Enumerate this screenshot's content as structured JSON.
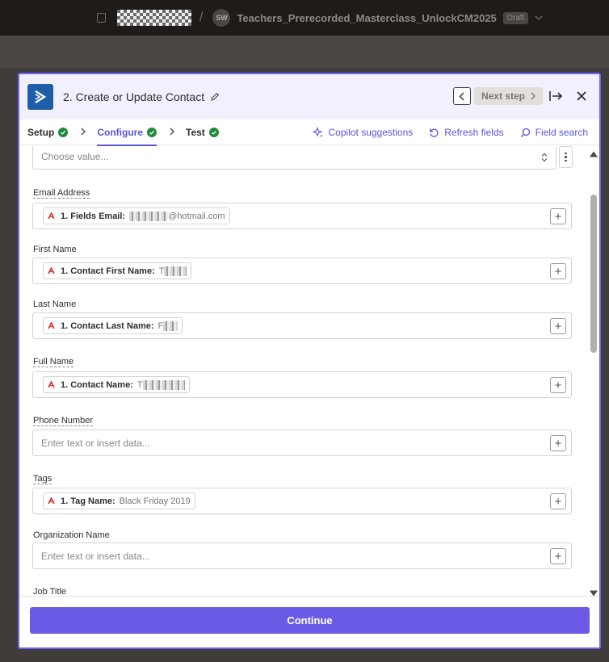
{
  "topbar": {
    "workspace_redacted": "",
    "separator": "/",
    "avatar_initials": "SW",
    "zap_title": "Teachers_Prerecorded_Masterclass_UnlockCM2025",
    "status_badge": "Draft"
  },
  "panel": {
    "step_title": "2. Create or Update Contact",
    "next_step_label": "Next step",
    "tabs": [
      {
        "label": "Setup",
        "status": "complete"
      },
      {
        "label": "Configure",
        "status": "complete",
        "active": true
      },
      {
        "label": "Test",
        "status": "complete"
      }
    ],
    "tools": {
      "copilot": "Copilot suggestions",
      "refresh": "Refresh fields",
      "search": "Field search"
    },
    "top_select": {
      "placeholder": "Choose value..."
    },
    "fields": {
      "email": {
        "label": "Email Address",
        "pill_label": "1. Fields Email:",
        "pill_value_suffix": "@hotmail.com"
      },
      "first_name": {
        "label": "First Name",
        "pill_label": "1. Contact First Name:",
        "pill_value_prefix": "T"
      },
      "last_name": {
        "label": "Last Name",
        "pill_label": "1. Contact Last Name:",
        "pill_value_prefix": "F"
      },
      "full_name": {
        "label": "Full Name",
        "pill_label": "1. Contact Name:",
        "pill_value_prefix": "T"
      },
      "phone": {
        "label": "Phone Number",
        "placeholder": "Enter text or insert data..."
      },
      "tags": {
        "label": "Tags",
        "pill_label": "1. Tag Name:",
        "pill_value": "Black Friday 2019"
      },
      "organization": {
        "label": "Organization Name",
        "placeholder": "Enter text or insert data..."
      },
      "job_title": {
        "label": "Job Title"
      }
    },
    "insert_symbol": "+",
    "continue_label": "Continue"
  },
  "colors": {
    "accent": "#6b5ce7",
    "link": "#5a55d6",
    "success": "#1f8a3b",
    "source_app": "#d9312b",
    "app_logo": "#1e5ea8"
  }
}
